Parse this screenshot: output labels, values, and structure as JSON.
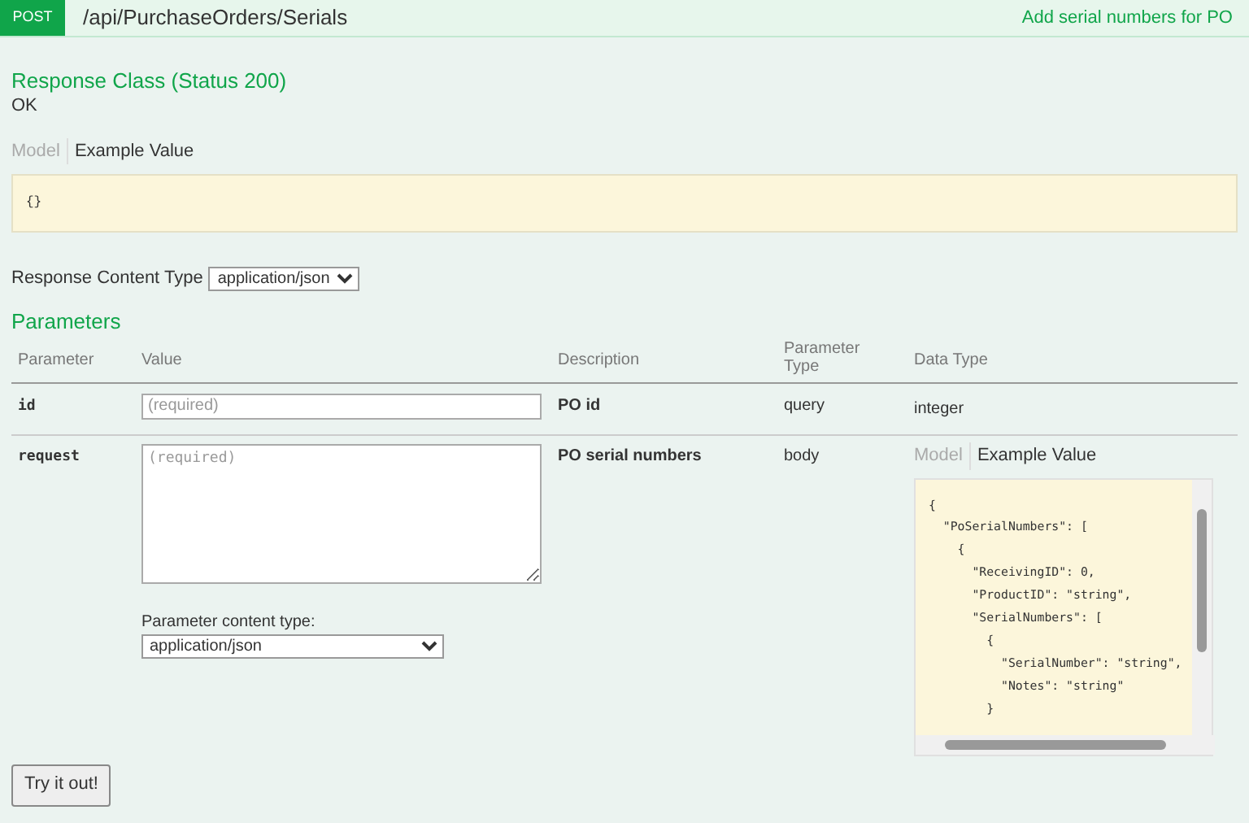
{
  "header": {
    "method": "POST",
    "path": "/api/PurchaseOrders/Serials",
    "summary": "Add serial numbers for PO"
  },
  "response": {
    "title": "Response Class (Status 200)",
    "message": "OK",
    "tabs": [
      {
        "label": "Model",
        "selected": false
      },
      {
        "label": "Example Value",
        "selected": true
      }
    ],
    "example": "{}"
  },
  "content_type": {
    "label": "Response Content Type",
    "value": "application/json"
  },
  "parameters": {
    "title": "Parameters",
    "columns": [
      "Parameter",
      "Value",
      "Description",
      "Parameter Type",
      "Data Type"
    ],
    "rows": [
      {
        "kind": "input",
        "name": "id",
        "placeholder": "(required)",
        "description": "PO id",
        "param_type": "query",
        "data_type": "integer"
      },
      {
        "kind": "body",
        "name": "request",
        "placeholder": "(required)",
        "content_type_label": "Parameter content type:",
        "content_type": "application/json",
        "description": "PO serial numbers",
        "param_type": "body",
        "tabs": [
          {
            "label": "Model",
            "selected": false
          },
          {
            "label": "Example Value",
            "selected": true
          }
        ],
        "example_lines": [
          "{",
          "  \"PoSerialNumbers\": [",
          "    {",
          "      \"ReceivingID\": 0,",
          "      \"ProductID\": \"string\",",
          "      \"SerialNumbers\": [",
          "        {",
          "          \"SerialNumber\": \"string\",",
          "          \"Notes\": \"string\"",
          "        }"
        ]
      }
    ]
  },
  "try_button": "Try it out!"
}
